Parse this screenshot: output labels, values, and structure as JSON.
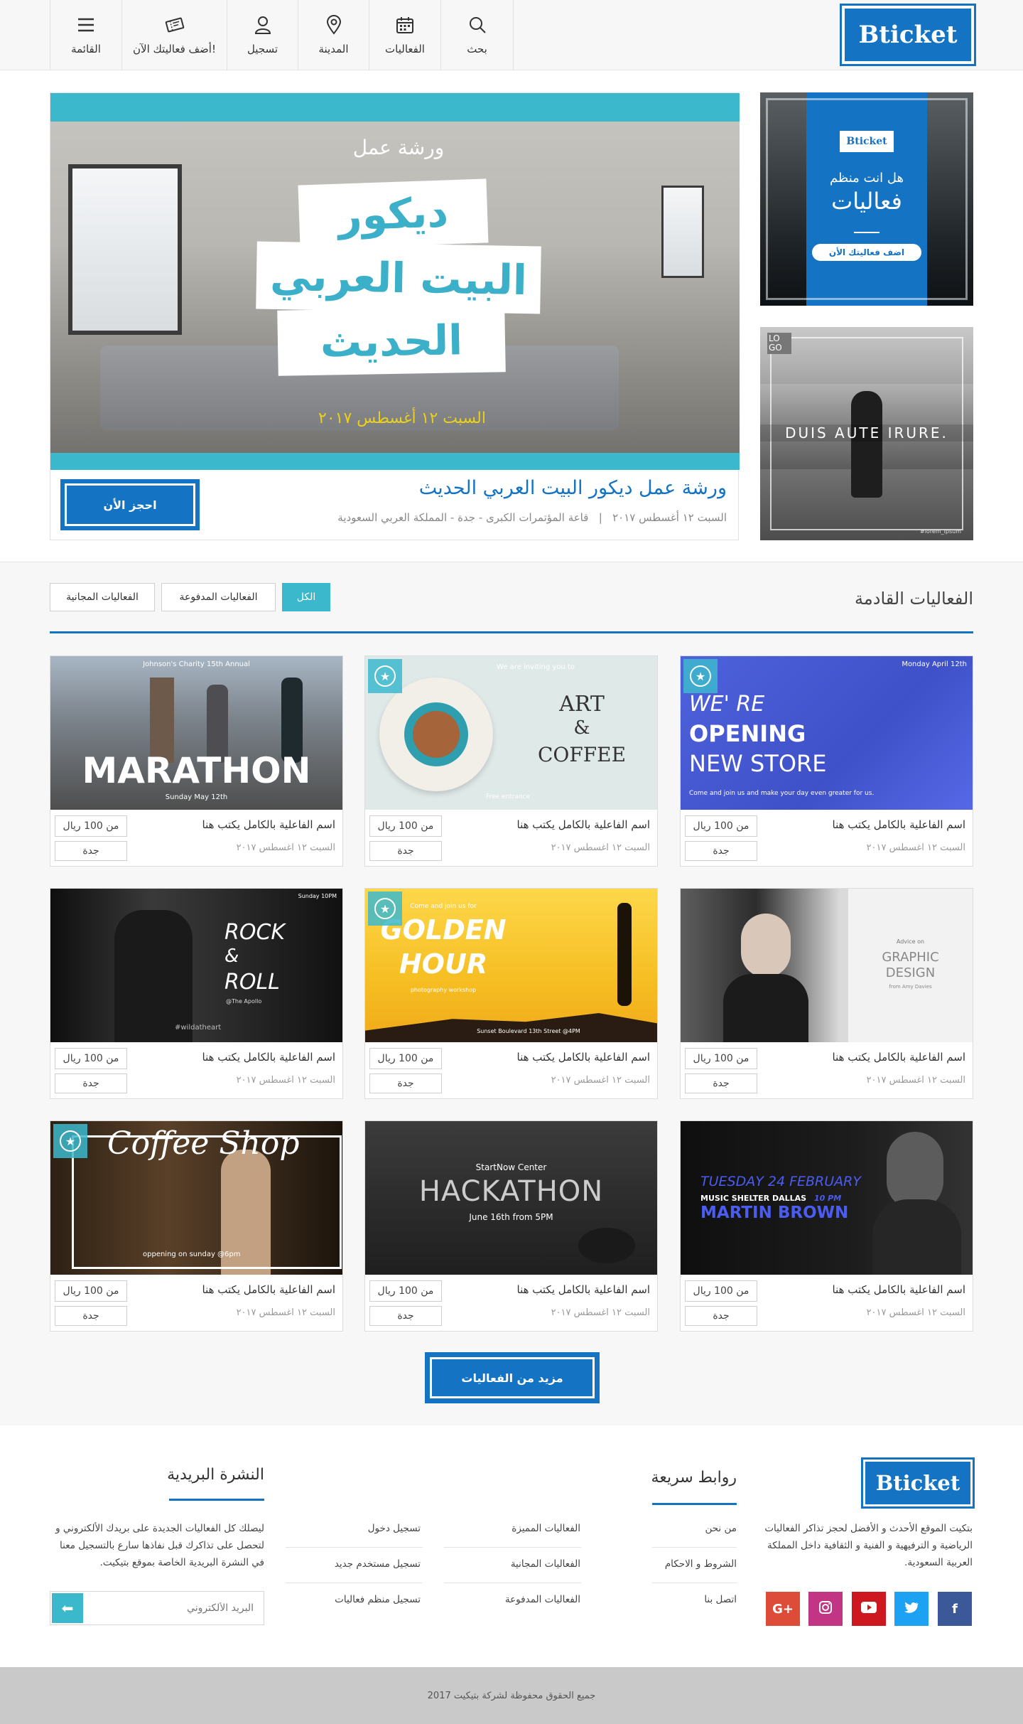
{
  "header": {
    "logo": "Bticket",
    "nav": [
      {
        "label": "بحث",
        "icon": "search-icon"
      },
      {
        "label": "الفعاليات",
        "icon": "calendar-icon"
      },
      {
        "label": "المدينة",
        "icon": "location-pin-icon"
      },
      {
        "label": "تسجيل",
        "icon": "user-icon"
      },
      {
        "label": "أضف فعاليتك الآن!",
        "icon": "ticket-icon"
      },
      {
        "label": "القائمة",
        "icon": "hamburger-menu-icon"
      }
    ]
  },
  "hero": {
    "banner_small": "ورشة عمل",
    "banner_line1": "ديكور",
    "banner_line2": "البيت العربي",
    "banner_line3": "الحديث",
    "banner_date": "السبت ١٢ أغسطس ٢٠١٧",
    "title": "ورشة عمل ديكور البيت العربي الحديث",
    "meta_location": "قاعة المؤتمرات الكبرى - جدة - المملكة العربي السعودية",
    "meta_separator": "|",
    "meta_date": "السبت ١٢ أغسطس ٢٠١٧",
    "book_button": "احجز الأن"
  },
  "ads": {
    "ad1_logo": "Bticket",
    "ad1_line1": "هل انت منظم",
    "ad1_line2": "فعاليات",
    "ad1_button": "اضف فعاليتك الأن",
    "ad2_logo": "LO GO",
    "ad2_text": "DUIS AUTE IRURE.",
    "ad2_handle": "#lorem_ipsum"
  },
  "events_section": {
    "title": "الفعاليات القادمة",
    "filters": [
      "الكل",
      "الفعاليات المدفوعة",
      "الفعاليات المجانية"
    ],
    "more_button": "مزيد من الفعاليات"
  },
  "events": [
    {
      "name": "اسم الفاعلية بالكامل يكتب هنا",
      "date": "السبت ١٢ اغسطس ٢٠١٧",
      "price": "من 100 ريال",
      "city": "جدة",
      "featured": true,
      "poster": {
        "top": "Monday April 12th",
        "l1": "WE' RE",
        "l2": "OPENING",
        "l3": "NEW STORE",
        "bottom": "Come and join us and make your day even greater for us."
      }
    },
    {
      "name": "اسم الفاعلية بالكامل يكتب هنا",
      "date": "السبت ١٢ اغسطس ٢٠١٧",
      "price": "من 100 ريال",
      "city": "جدة",
      "featured": true,
      "poster": {
        "top": "We are inviting you to",
        "l1": "ART",
        "l2": "&",
        "l3": "COFFEE",
        "bottom": "Free entrance"
      }
    },
    {
      "name": "اسم الفاعلية بالكامل يكتب هنا",
      "date": "السبت ١٢ اغسطس ٢٠١٧",
      "price": "من 100 ريال",
      "city": "جدة",
      "featured": false,
      "poster": {
        "top": "Johnson's Charity 15th Annual",
        "l1": "MARATHON",
        "l2": "",
        "l3": "",
        "bottom": "Sunday May 12th"
      }
    },
    {
      "name": "اسم الفاعلية بالكامل يكتب هنا",
      "date": "السبت ١٢ اغسطس ٢٠١٧",
      "price": "من 100 ريال",
      "city": "جدة",
      "featured": false,
      "poster": {
        "top": "Advice on",
        "l1": "GRAPHIC",
        "l2": "DESIGN",
        "l3": "",
        "bottom": "from Amy Davies"
      }
    },
    {
      "name": "اسم الفاعلية بالكامل يكتب هنا",
      "date": "السبت ١٢ اغسطس ٢٠١٧",
      "price": "من 100 ريال",
      "city": "جدة",
      "featured": true,
      "poster": {
        "top": "Come and join us for",
        "l1": "GOLDEN",
        "l2": "HOUR",
        "l3": "photography workshop",
        "bottom": "Sunset Boulevard 13th Street @4PM"
      }
    },
    {
      "name": "اسم الفاعلية بالكامل يكتب هنا",
      "date": "السبت ١٢ اغسطس ٢٠١٧",
      "price": "من 100 ريال",
      "city": "جدة",
      "featured": false,
      "poster": {
        "top": "Sunday 10PM",
        "l1": "ROCK",
        "l2": "&",
        "l3": "ROLL",
        "bottom": "#wildatheart",
        "sub": "@The Apollo"
      }
    },
    {
      "name": "اسم الفاعلية بالكامل يكتب هنا",
      "date": "السبت ١٢ اغسطس ٢٠١٧",
      "price": "من 100 ريال",
      "city": "جدة",
      "featured": false,
      "poster": {
        "top": "TUESDAY 24 FEBRUARY",
        "l1": "MUSIC SHELTER DALLAS",
        "l2": "10 PM",
        "l3": "MARTIN BROWN",
        "bottom": ""
      }
    },
    {
      "name": "اسم الفاعلية بالكامل يكتب هنا",
      "date": "السبت ١٢ اغسطس ٢٠١٧",
      "price": "من 100 ريال",
      "city": "جدة",
      "featured": false,
      "poster": {
        "top": "StartNow Center",
        "l1": "HACKATHON",
        "l2": "June 16th from 5PM",
        "l3": "",
        "bottom": ""
      }
    },
    {
      "name": "اسم الفاعلية بالكامل يكتب هنا",
      "date": "السبت ١٢ اغسطس ٢٠١٧",
      "price": "من 100 ريال",
      "city": "جدة",
      "featured": true,
      "poster": {
        "top": "",
        "l1": "Coffee Shop",
        "l2": "",
        "l3": "",
        "bottom": "oppening on sunday @6pm"
      }
    }
  ],
  "footer": {
    "logo": "Bticket",
    "about": "بتكيت الموقع الأحدث و الأفضل لحجز تذاكر الفعاليات الرياضية و الترفيهية و الفنية و الثقافية داخل المملكة العربية السعودية.",
    "quick_links_title": "روابط سريعة",
    "links_col1": [
      "من نحن",
      "الشروط و الاحكام",
      "اتصل بنا"
    ],
    "links_col2": [
      "الفعاليات المميزة",
      "الفعاليات المجانية",
      "الفعاليات المدفوعة"
    ],
    "links_col3": [
      "تسجيل دخول",
      "تسجيل مستخدم جديد",
      "تسجيل منظم فعاليات"
    ],
    "newsletter_title": "النشرة البريدية",
    "newsletter_text": "ليصلك كل الفعاليات الجديدة على بريدك الألكتروني و لتحصل على تذاكرك قبل نفاذها سارع بالتسجيل معنا في النشرة البريدية الخاصة بموقع بتيكيت.",
    "email_placeholder": "البريد الألكتروني",
    "social": [
      {
        "name": "facebook",
        "glyph": "f",
        "color": "#3b5998"
      },
      {
        "name": "twitter",
        "glyph": "t",
        "color": "#1da1f2"
      },
      {
        "name": "youtube",
        "glyph": "▶",
        "color": "#cc181e"
      },
      {
        "name": "instagram",
        "glyph": "◎",
        "color": "#c13584"
      },
      {
        "name": "google-plus",
        "glyph": "G+",
        "color": "#dd4b39"
      }
    ],
    "copyright": "جميع الحقوق محفوظة لشركة بتيكيت 2017"
  }
}
